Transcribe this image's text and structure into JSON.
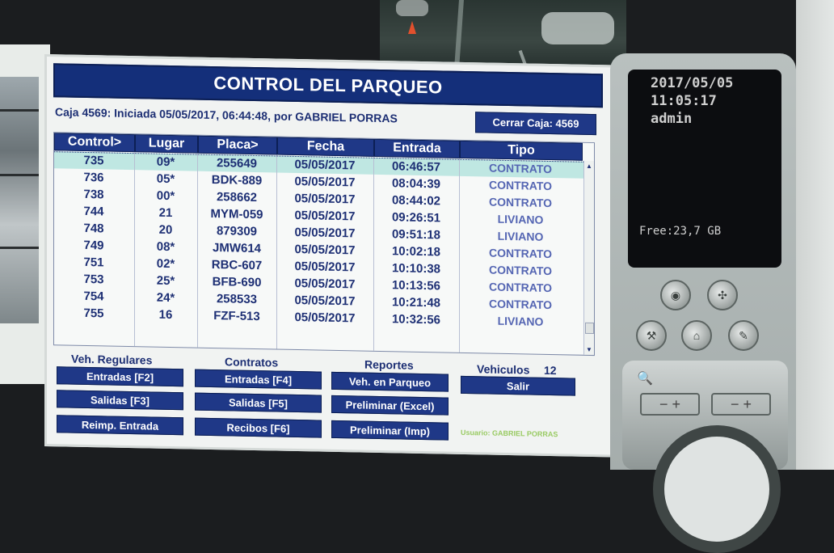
{
  "app": {
    "title": "CONTROL DEL PARQUEO",
    "session": "Caja 4569:  Iniciada 05/05/2017,  06:44:48,  por GABRIEL PORRAS",
    "close_button": "Cerrar Caja: 4569"
  },
  "table": {
    "headers": [
      "Control>",
      "Lugar",
      "Placa>",
      "Fecha",
      "Entrada",
      "Tipo"
    ],
    "rows": [
      {
        "control": "735",
        "lugar": "09*",
        "placa": "255649",
        "fecha": "05/05/2017",
        "entrada": "06:46:57",
        "tipo": "CONTRATO",
        "selected": true
      },
      {
        "control": "736",
        "lugar": "05*",
        "placa": "BDK-889",
        "fecha": "05/05/2017",
        "entrada": "08:04:39",
        "tipo": "CONTRATO"
      },
      {
        "control": "738",
        "lugar": "00*",
        "placa": "258662",
        "fecha": "05/05/2017",
        "entrada": "08:44:02",
        "tipo": "CONTRATO"
      },
      {
        "control": "744",
        "lugar": "21",
        "placa": "MYM-059",
        "fecha": "05/05/2017",
        "entrada": "09:26:51",
        "tipo": "LIVIANO"
      },
      {
        "control": "748",
        "lugar": "20",
        "placa": "879309",
        "fecha": "05/05/2017",
        "entrada": "09:51:18",
        "tipo": "LIVIANO"
      },
      {
        "control": "749",
        "lugar": "08*",
        "placa": "JMW614",
        "fecha": "05/05/2017",
        "entrada": "10:02:18",
        "tipo": "CONTRATO"
      },
      {
        "control": "751",
        "lugar": "02*",
        "placa": "RBC-607",
        "fecha": "05/05/2017",
        "entrada": "10:10:38",
        "tipo": "CONTRATO"
      },
      {
        "control": "753",
        "lugar": "25*",
        "placa": "BFB-690",
        "fecha": "05/05/2017",
        "entrada": "10:13:56",
        "tipo": "CONTRATO"
      },
      {
        "control": "754",
        "lugar": "24*",
        "placa": "258533",
        "fecha": "05/05/2017",
        "entrada": "10:21:48",
        "tipo": "CONTRATO"
      },
      {
        "control": "755",
        "lugar": "16",
        "placa": "FZF-513",
        "fecha": "05/05/2017",
        "entrada": "10:32:56",
        "tipo": "LIVIANO"
      }
    ]
  },
  "sections": {
    "regulares": {
      "label": "Veh. Regulares",
      "buttons": [
        "Entradas [F2]",
        "Salidas  [F3]",
        "Reimp. Entrada"
      ]
    },
    "contratos": {
      "label": "Contratos",
      "buttons": [
        "Entradas  [F4]",
        "Salidas  [F5]",
        "Recibos  [F6]"
      ]
    },
    "reportes": {
      "label": "Reportes",
      "buttons": [
        "Veh. en Parqueo",
        "Preliminar (Excel)",
        "Preliminar (Imp)"
      ]
    },
    "vehiculos": {
      "label": "Vehiculos",
      "count": "12",
      "exit_button": "Salir"
    }
  },
  "user_label": "Usuario:  GABRIEL PORRAS",
  "dvr": {
    "date": "2017/05/05",
    "time": "11:05:17",
    "user": "admin",
    "free": "Free:23,7 GB"
  },
  "icons": {
    "scroll_up": "▲",
    "scroll_down": "▼",
    "zoom": "🔍"
  }
}
